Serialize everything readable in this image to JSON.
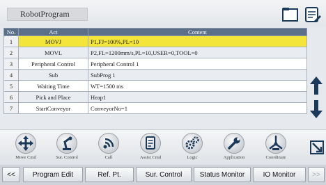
{
  "header": {
    "program_name": "RobotProgram",
    "icon_select": "select-frame-icon",
    "icon_edit": "edit-document-icon"
  },
  "table": {
    "columns": [
      "No.",
      "Act",
      "Content"
    ],
    "rows": [
      {
        "no": "1",
        "act": "MOVJ",
        "content": "P1,FJ=100%,PL=10",
        "highlighted": true
      },
      {
        "no": "2",
        "act": "MOVL",
        "content": "P2,FL=1200mm/s,PL=10,USER=0,TOOL=0",
        "highlighted": false
      },
      {
        "no": "3",
        "act": "Peripheral Control",
        "content": "Peripheral Control 1",
        "highlighted": false
      },
      {
        "no": "4",
        "act": "Sub",
        "content": "SubProg 1",
        "highlighted": false
      },
      {
        "no": "5",
        "act": "Waiting Time",
        "content": "WT=1500 ms",
        "highlighted": false
      },
      {
        "no": "6",
        "act": "Pick and Place",
        "content": "Heap1",
        "highlighted": false
      },
      {
        "no": "7",
        "act": "StartConveyor",
        "content": "ConveyorNo=1",
        "highlighted": false
      }
    ],
    "highlight_color": "#f3e53a"
  },
  "side": {
    "up_icon": "arrow-up-icon",
    "down_icon": "arrow-down-icon",
    "corner_icon": "resize-icon"
  },
  "tools": [
    {
      "label": "Move Cmd",
      "icon": "move-arrows-icon"
    },
    {
      "label": "Sur. Control",
      "icon": "robot-arm-icon"
    },
    {
      "label": "Call",
      "icon": "signal-icon"
    },
    {
      "label": "Assist Cmd",
      "icon": "document-icon"
    },
    {
      "label": "Logic",
      "icon": "gears-icon"
    },
    {
      "label": "Application",
      "icon": "wrench-icon"
    },
    {
      "label": "Coordinate",
      "icon": "coordinate-icon"
    }
  ],
  "bottom_nav": {
    "prev": "<<",
    "program_edit": "Program Edit",
    "ref_pt": "Ref. Pt.",
    "sur_control": "Sur. Control",
    "status_monitor": "Status Monitor",
    "io_monitor": "IO Monitor",
    "next": ">>"
  }
}
